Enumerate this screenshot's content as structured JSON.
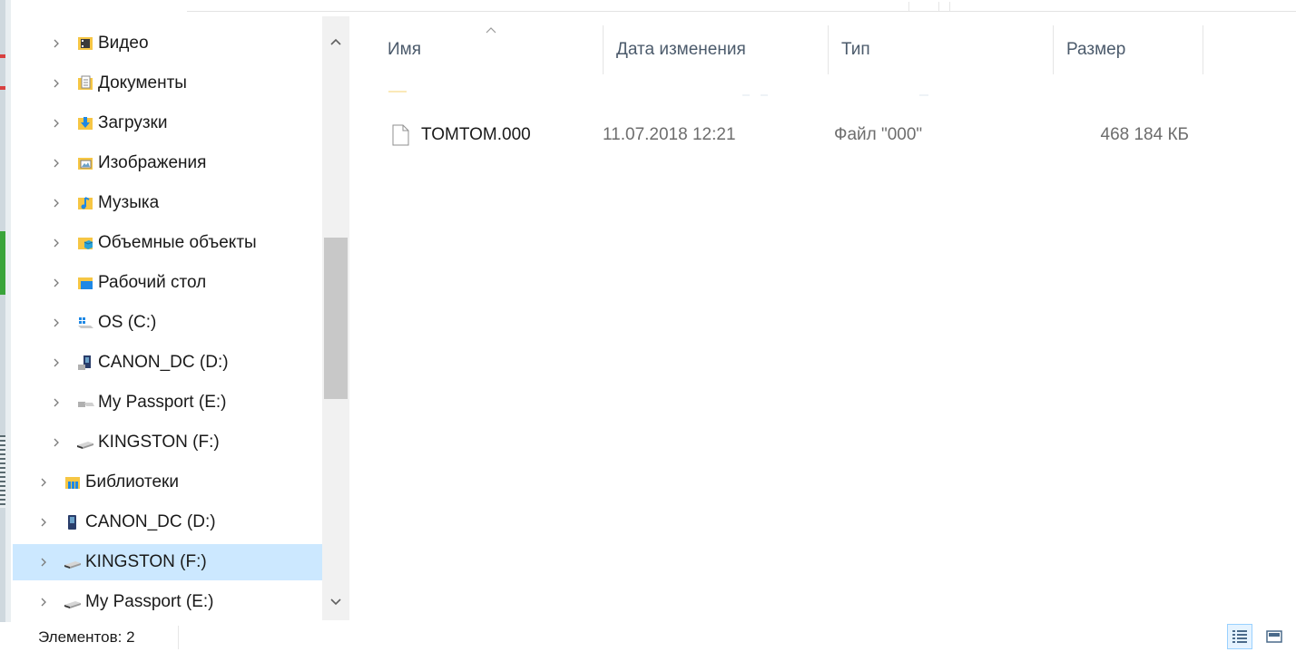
{
  "nav": {
    "items": [
      {
        "label": "Видео",
        "icon": "video-folder-icon",
        "level": 1
      },
      {
        "label": "Документы",
        "icon": "documents-folder-icon",
        "level": 1
      },
      {
        "label": "Загрузки",
        "icon": "downloads-folder-icon",
        "level": 1
      },
      {
        "label": "Изображения",
        "icon": "pictures-folder-icon",
        "level": 1
      },
      {
        "label": "Музыка",
        "icon": "music-folder-icon",
        "level": 1
      },
      {
        "label": "Объемные объекты",
        "icon": "3d-objects-folder-icon",
        "level": 1
      },
      {
        "label": "Рабочий стол",
        "icon": "desktop-folder-icon",
        "level": 1
      },
      {
        "label": "OS (C:)",
        "icon": "system-drive-icon",
        "level": 1
      },
      {
        "label": "CANON_DC (D:)",
        "icon": "camera-drive-icon",
        "level": 1
      },
      {
        "label": "My Passport (E:)",
        "icon": "external-drive-icon",
        "level": 1
      },
      {
        "label": "KINGSTON (F:)",
        "icon": "usb-drive-icon",
        "level": 1
      },
      {
        "label": "Библиотеки",
        "icon": "libraries-icon",
        "level": 0
      },
      {
        "label": "CANON_DC (D:)",
        "icon": "camera-device-icon",
        "level": 0
      },
      {
        "label": "KINGSTON (F:)",
        "icon": "usb-drive-icon",
        "level": 0,
        "selected": true
      },
      {
        "label": "My Passport (E:)",
        "icon": "usb-drive-icon",
        "level": 0
      }
    ]
  },
  "columns": {
    "name": "Имя",
    "modified": "Дата изменения",
    "type": "Тип",
    "size": "Размер"
  },
  "files": [
    {
      "name": "TOMTOM.000",
      "modified": "11.07.2018 12:21",
      "type": "Файл \"000\"",
      "size": "468 184 КБ",
      "icon": "generic-file-icon"
    }
  ],
  "status": {
    "items_count": "Элементов: 2"
  },
  "colors": {
    "selection": "#cce8ff",
    "header_text": "#4b5a6b",
    "folder_yellow": "#f6c644",
    "accent_blue": "#1e88e5"
  }
}
